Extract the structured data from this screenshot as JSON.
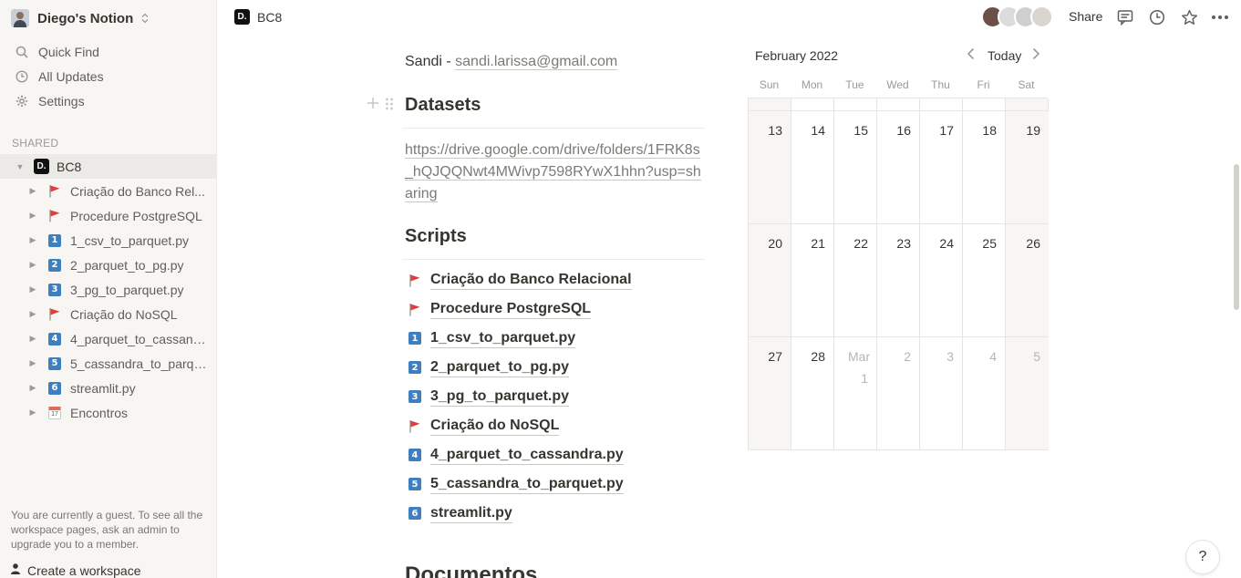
{
  "workspace": {
    "name": "Diego's Notion"
  },
  "sidebar": {
    "nav": [
      {
        "label": "Quick Find",
        "icon": "search-icon"
      },
      {
        "label": "All Updates",
        "icon": "clock-icon"
      },
      {
        "label": "Settings",
        "icon": "gear-icon"
      }
    ],
    "section_label": "SHARED",
    "root": {
      "label": "BC8",
      "logo": "D."
    },
    "pages": [
      {
        "label": "Criação do Banco Rel...",
        "icon": "red-flag"
      },
      {
        "label": "Procedure PostgreSQL",
        "icon": "red-flag"
      },
      {
        "label": "1_csv_to_parquet.py",
        "icon": "number-badge",
        "badge": "1"
      },
      {
        "label": "2_parquet_to_pg.py",
        "icon": "number-badge",
        "badge": "2"
      },
      {
        "label": "3_pg_to_parquet.py",
        "icon": "number-badge",
        "badge": "3"
      },
      {
        "label": "Criação do NoSQL",
        "icon": "red-flag"
      },
      {
        "label": "4_parquet_to_cassand...",
        "icon": "number-badge",
        "badge": "4"
      },
      {
        "label": "5_cassandra_to_parqu...",
        "icon": "number-badge",
        "badge": "5"
      },
      {
        "label": "streamlit.py",
        "icon": "number-badge",
        "badge": "6"
      },
      {
        "label": "Encontros",
        "icon": "calendar-icon"
      }
    ],
    "guest_note": "You are currently a guest. To see all the workspace pages, ask an admin to upgrade you to a member.",
    "create_workspace": "Create a workspace"
  },
  "topbar": {
    "breadcrumb": {
      "logo": "D.",
      "title": "BC8"
    },
    "share_label": "Share"
  },
  "content": {
    "contact_name": "Sandi - ",
    "contact_email": "sandi.larissa@gmail.com",
    "datasets_heading": "Datasets",
    "datasets_link": "https://drive.google.com/drive/folders/1FRK8s_hQJQQNwt4MWivp7598RYwX1hhn?usp=sharing",
    "scripts_heading": "Scripts",
    "scripts": [
      {
        "label": "Criação do Banco Relacional",
        "icon": "red-flag"
      },
      {
        "label": "Procedure PostgreSQL",
        "icon": "red-flag"
      },
      {
        "label": "1_csv_to_parquet.py",
        "icon": "number-badge",
        "badge": "1"
      },
      {
        "label": "2_parquet_to_pg.py",
        "icon": "number-badge",
        "badge": "2"
      },
      {
        "label": "3_pg_to_parquet.py",
        "icon": "number-badge",
        "badge": "3"
      },
      {
        "label": "Criação do NoSQL",
        "icon": "red-flag"
      },
      {
        "label": "4_parquet_to_cassandra.py",
        "icon": "number-badge",
        "badge": "4"
      },
      {
        "label": "5_cassandra_to_parquet.py",
        "icon": "number-badge",
        "badge": "5"
      },
      {
        "label": "streamlit.py",
        "icon": "number-badge",
        "badge": "6"
      }
    ],
    "documentos_heading": "Documentos"
  },
  "calendar": {
    "month_label": "February 2022",
    "today_label": "Today",
    "weekdays": [
      "Sun",
      "Mon",
      "Tue",
      "Wed",
      "Thu",
      "Fri",
      "Sat"
    ],
    "weeks": [
      [
        "13",
        "14",
        "15",
        "16",
        "17",
        "18",
        "19"
      ],
      [
        "20",
        "21",
        "22",
        "23",
        "24",
        "25",
        "26"
      ],
      [
        "27",
        "28",
        "Mar 1",
        "2",
        "3",
        "4",
        "5"
      ]
    ],
    "muted_from": [
      2,
      2
    ]
  },
  "help_label": "?",
  "colors": {
    "sidebar_bg": "#f7f6f3",
    "text": "#37352f",
    "flag_red": "#e03e3e",
    "badge_blue": "#3f7fbf"
  }
}
